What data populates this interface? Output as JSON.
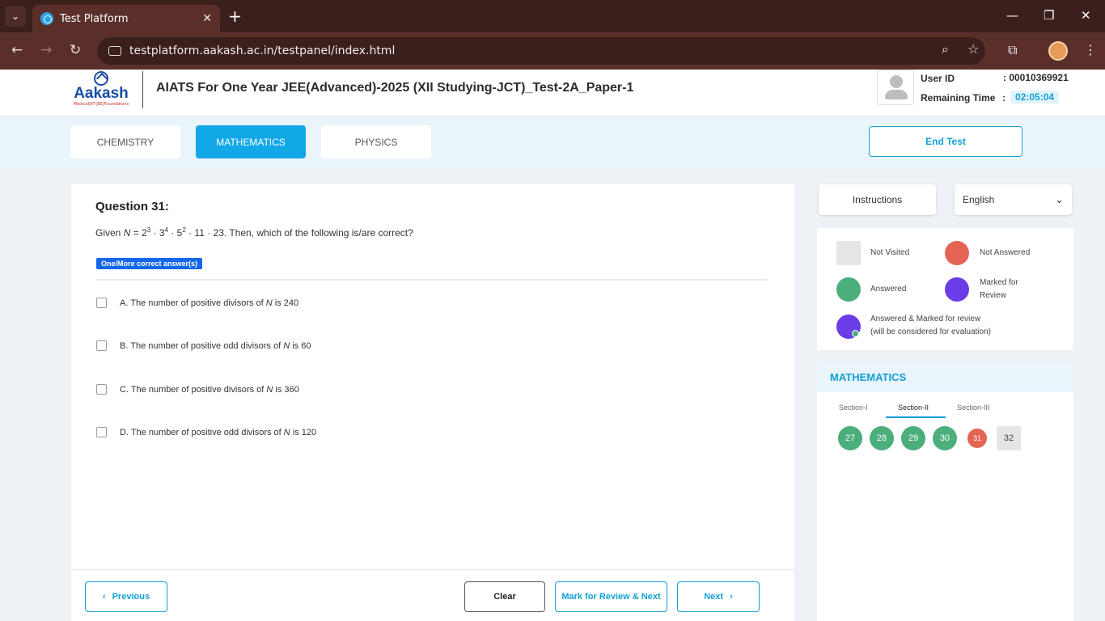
{
  "browser": {
    "tab_title": "Test Platform",
    "tab_close": "✕",
    "new_tab": "+",
    "url": "testplatform.aakash.ac.in/testpanel/index.html"
  },
  "header": {
    "logo_text": "Aakash",
    "logo_sub": "Medical|IIT-JEE|Foundations",
    "test_title": "AIATS For One Year JEE(Advanced)-2025 (XII Studying-JCT)_Test-2A_Paper-1",
    "user_id_label": "User ID",
    "user_id_value": ": 00010369921",
    "remaining_label": "Remaining Time",
    "remaining_colon": ":",
    "remaining_value": "02:05:04"
  },
  "subjects": [
    {
      "label": "CHEMISTRY",
      "active": false
    },
    {
      "label": "MATHEMATICS",
      "active": true
    },
    {
      "label": "PHYSICS",
      "active": false
    }
  ],
  "end_test_label": "End Test",
  "question": {
    "number_label": "Question 31:",
    "text_prefix": "Given ",
    "var_N": "N",
    "text_eq": " = 2",
    "exp1": "3",
    "mid1": " · 3",
    "exp2": "4",
    "mid2": " · 5",
    "exp3": "2",
    "text_suffix": " · 11 · 23. Then, which of the following is/are correct?",
    "badge": "One/More correct answer(s)",
    "options": [
      {
        "prefix": "A. The number of positive divisors of ",
        "var": "N",
        "suffix": " is 240"
      },
      {
        "prefix": "B. The number of positive odd divisors of ",
        "var": "N",
        "suffix": " is 60"
      },
      {
        "prefix": "C. The number of positive divisors of ",
        "var": "N",
        "suffix": " is 360"
      },
      {
        "prefix": "D. The number of positive odd divisors of ",
        "var": "N",
        "suffix": " is 120"
      }
    ]
  },
  "buttons": {
    "previous": "Previous",
    "clear": "Clear",
    "mark_review_next": "Mark for Review & Next",
    "next": "Next"
  },
  "side": {
    "instructions": "Instructions",
    "language": "English"
  },
  "legend": {
    "not_visited": "Not Visited",
    "not_answered": "Not Answered",
    "answered": "Answered",
    "marked_line1": "Marked for",
    "marked_line2": "Review",
    "answered_marked_line1": "Answered & Marked for review",
    "answered_marked_line2": "(will be considered for evaluation)"
  },
  "palette": {
    "title": "MATHEMATICS",
    "sections": [
      "Section-I",
      "Section-II",
      "Section-III"
    ],
    "active_section": "Section-II",
    "questions": [
      {
        "num": "27",
        "status": "answered"
      },
      {
        "num": "28",
        "status": "answered"
      },
      {
        "num": "29",
        "status": "answered"
      },
      {
        "num": "30",
        "status": "answered"
      },
      {
        "num": "31",
        "status": "not_answered"
      },
      {
        "num": "32",
        "status": "not_visited"
      }
    ]
  },
  "colors": {
    "accent": "#12a0d7",
    "answered": "#4cae7a",
    "not_answered": "#e56555",
    "marked": "#6a3de8",
    "not_visited": "#e5e5e5"
  }
}
